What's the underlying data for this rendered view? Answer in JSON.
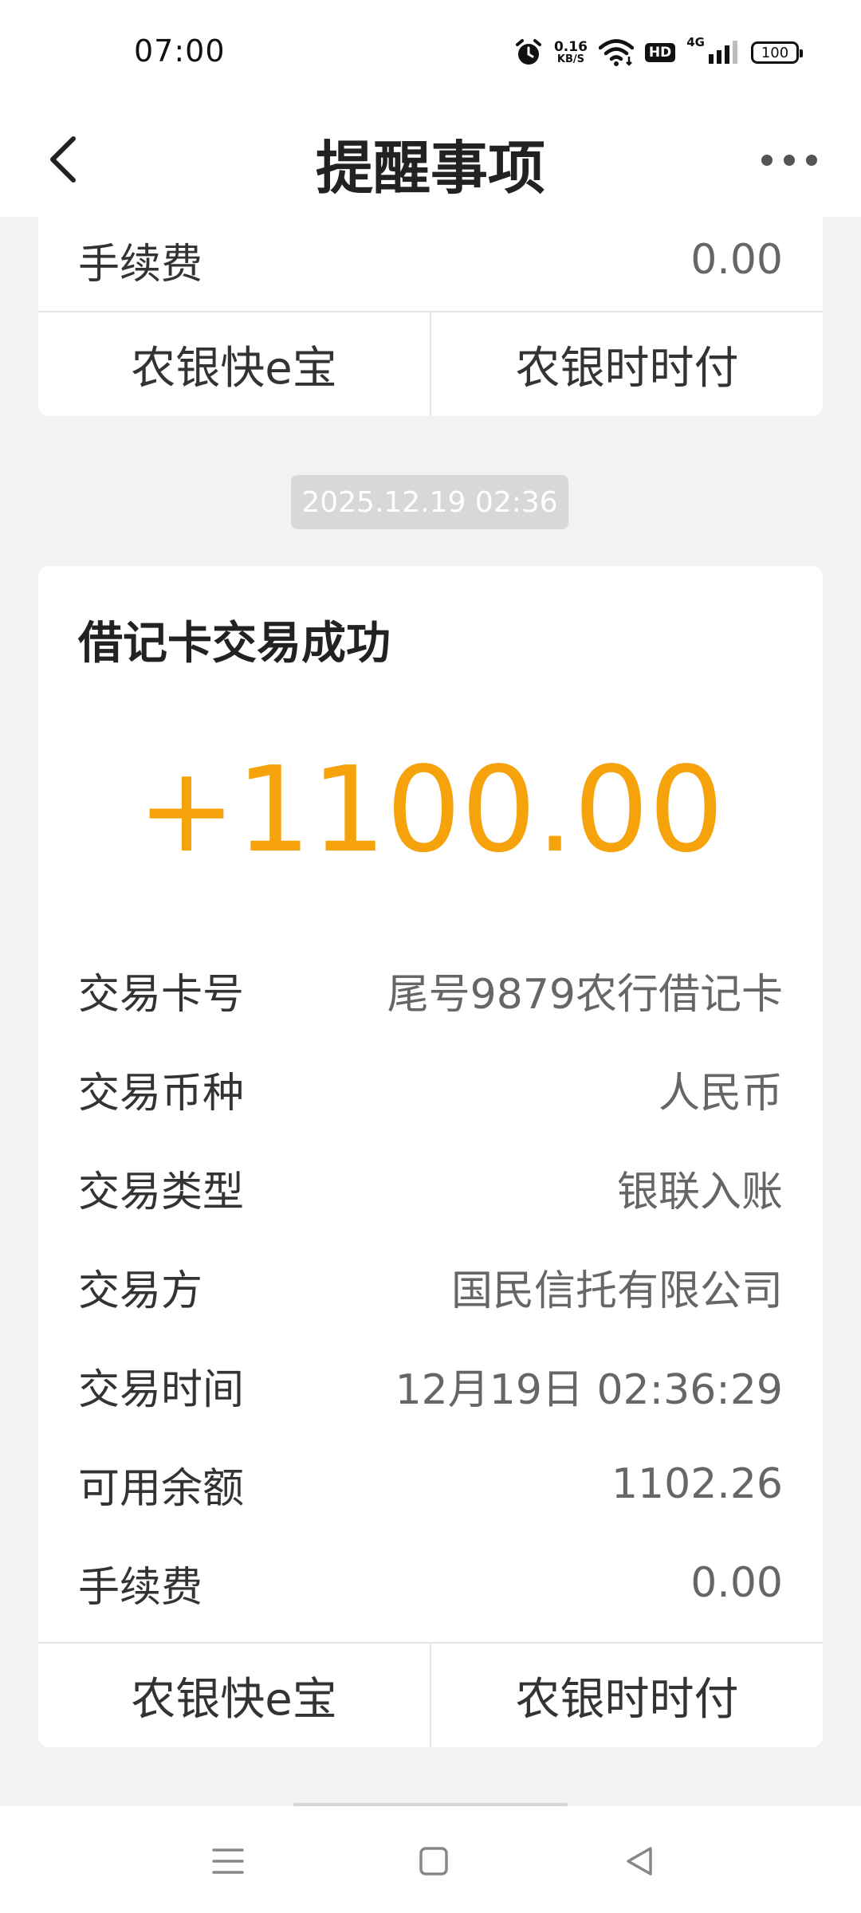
{
  "status_bar": {
    "time": "07:00",
    "net_speed_value": "0.16",
    "net_speed_unit": "KB/S",
    "hd_label": "HD",
    "network_type": "4G",
    "battery": "100"
  },
  "header": {
    "title": "提醒事项"
  },
  "prev_card": {
    "fee_label": "手续费",
    "fee_value": "0.00",
    "action_left": "农银快e宝",
    "action_right": "农银时时付"
  },
  "date_chip": "2025.12.19 02:36",
  "main_card": {
    "title": "借记卡交易成功",
    "amount": "+1100.00",
    "rows": [
      {
        "label": "交易卡号",
        "value": "尾号9879农行借记卡"
      },
      {
        "label": "交易币种",
        "value": "人民币"
      },
      {
        "label": "交易类型",
        "value": "银联入账"
      },
      {
        "label": "交易方",
        "value": "国民信托有限公司"
      },
      {
        "label": "交易时间",
        "value": "12月19日 02:36:29"
      },
      {
        "label": "可用余额",
        "value": "1102.26"
      },
      {
        "label": "手续费",
        "value": "0.00"
      }
    ],
    "action_left": "农银快e宝",
    "action_right": "农银时时付"
  },
  "colors": {
    "amount": "#f5a20b",
    "background": "#f2f2f2",
    "card": "#ffffff",
    "date_chip": "#d8d8d8"
  },
  "icons": {
    "back": "chevron-left-icon",
    "more": "more-dots-icon",
    "alarm": "alarm-icon",
    "wifi": "wifi-icon",
    "signal": "signal-icon",
    "nav_menu": "menu-icon",
    "nav_home": "home-square-icon",
    "nav_back": "back-triangle-icon"
  }
}
